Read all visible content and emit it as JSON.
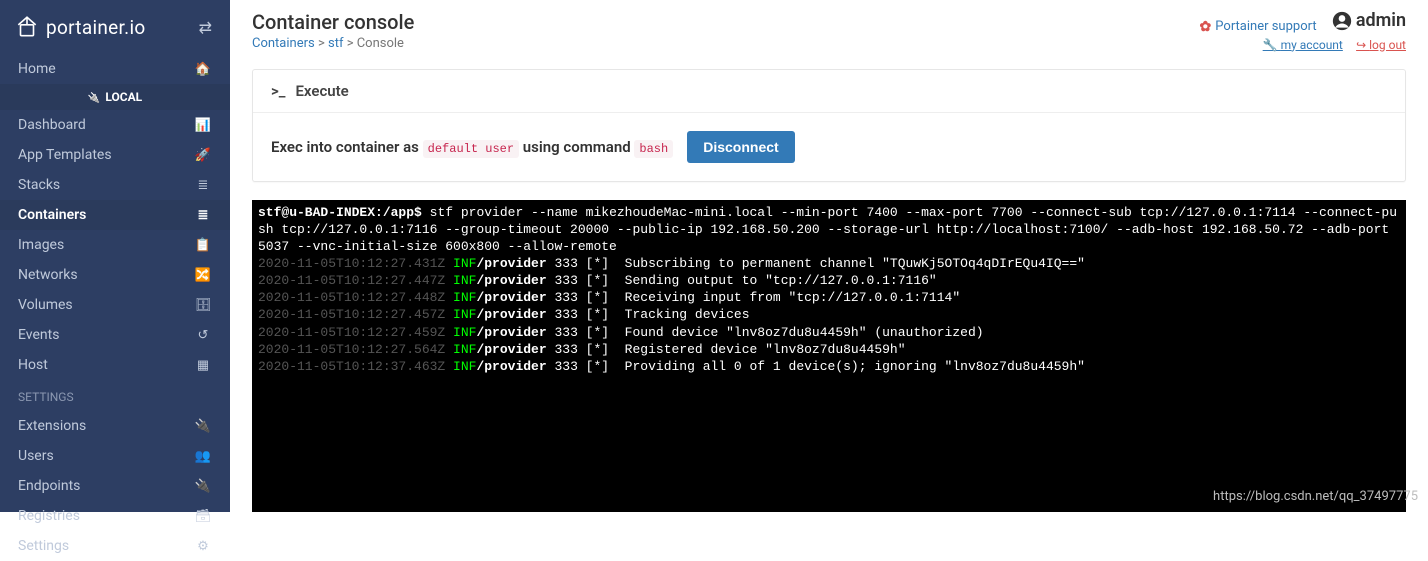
{
  "brand": "portainer.io",
  "sidebar": {
    "local_label": "LOCAL",
    "settings_header": "SETTINGS",
    "items_top": [
      {
        "label": "Home",
        "icon": "🏠"
      }
    ],
    "items_local": [
      {
        "label": "Dashboard",
        "icon": "📊"
      },
      {
        "label": "App Templates",
        "icon": "🚀"
      },
      {
        "label": "Stacks",
        "icon": "≣"
      },
      {
        "label": "Containers",
        "icon": "≣",
        "active": true
      },
      {
        "label": "Images",
        "icon": "📋"
      },
      {
        "label": "Networks",
        "icon": "🔀"
      },
      {
        "label": "Volumes",
        "icon": "🗄"
      },
      {
        "label": "Events",
        "icon": "↺"
      },
      {
        "label": "Host",
        "icon": "▦"
      }
    ],
    "items_settings": [
      {
        "label": "Extensions",
        "icon": "🔌"
      },
      {
        "label": "Users",
        "icon": "👥"
      },
      {
        "label": "Endpoints",
        "icon": "🔌"
      },
      {
        "label": "Registries",
        "icon": "🗃"
      },
      {
        "label": "Settings",
        "icon": "⚙"
      }
    ]
  },
  "header": {
    "title": "Container console",
    "breadcrumb": {
      "containers": "Containers",
      "container_name": "stf",
      "current": "Console"
    },
    "support": "Portainer support",
    "user": "admin",
    "my_account": "my account",
    "log_out": "log out"
  },
  "execute_panel": {
    "title": "Execute",
    "prefix": "Exec into container as",
    "user_value": "default user",
    "middle": "using command",
    "command_value": "bash",
    "disconnect": "Disconnect"
  },
  "terminal": {
    "prompt": "stf@u-BAD-INDEX:/app$ ",
    "cmd": "stf provider --name mikezhoudeMac-mini.local --min-port 7400 --max-port 7700 --connect-sub tcp://127.0.0.1:7114 --connect-push tcp://127.0.0.1:7116 --group-timeout 20000 --public-ip 192.168.50.200 --storage-url http://localhost:7100/ --adb-host 192.168.50.72 --adb-port 5037 --vnc-initial-size 600x800 --allow-remote",
    "lines": [
      {
        "ts": "2020-11-05T10:12:27.431Z",
        "lvl": "INF",
        "src": "/provider",
        "pid": "333",
        "mark": "[*]",
        "msg": "Subscribing to permanent channel \"TQuwKj5OTOq4qDIrEQu4IQ==\""
      },
      {
        "ts": "2020-11-05T10:12:27.447Z",
        "lvl": "INF",
        "src": "/provider",
        "pid": "333",
        "mark": "[*]",
        "msg": "Sending output to \"tcp://127.0.0.1:7116\""
      },
      {
        "ts": "2020-11-05T10:12:27.448Z",
        "lvl": "INF",
        "src": "/provider",
        "pid": "333",
        "mark": "[*]",
        "msg": "Receiving input from \"tcp://127.0.0.1:7114\""
      },
      {
        "ts": "2020-11-05T10:12:27.457Z",
        "lvl": "INF",
        "src": "/provider",
        "pid": "333",
        "mark": "[*]",
        "msg": "Tracking devices"
      },
      {
        "ts": "2020-11-05T10:12:27.459Z",
        "lvl": "INF",
        "src": "/provider",
        "pid": "333",
        "mark": "[*]",
        "msg": "Found device \"lnv8oz7du8u4459h\" (unauthorized)"
      },
      {
        "ts": "2020-11-05T10:12:27.564Z",
        "lvl": "INF",
        "src": "/provider",
        "pid": "333",
        "mark": "[*]",
        "msg": "Registered device \"lnv8oz7du8u4459h\""
      },
      {
        "ts": "2020-11-05T10:12:37.463Z",
        "lvl": "INF",
        "src": "/provider",
        "pid": "333",
        "mark": "[*]",
        "msg": "Providing all 0 of 1 device(s); ignoring \"lnv8oz7du8u4459h\""
      }
    ]
  },
  "watermark": "https://blog.csdn.net/qq_37497775"
}
